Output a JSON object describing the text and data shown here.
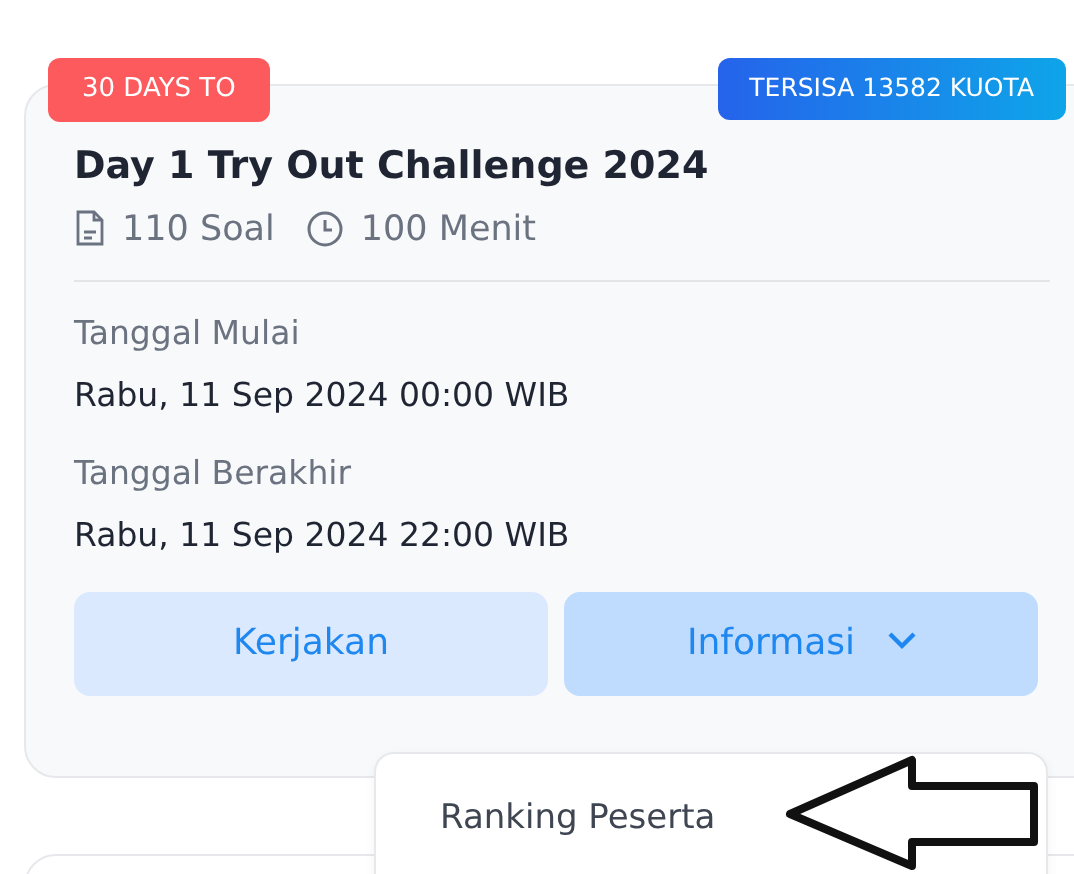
{
  "card": {
    "countdown_badge": "30 DAYS TO",
    "quota_badge": "TERSISA 13582 KUOTA",
    "title": "Day 1 Try Out Challenge 2024",
    "meta": [
      {
        "kind": "document",
        "text": "110 Soal"
      },
      {
        "kind": "clock",
        "text": "100 Menit"
      }
    ],
    "dates": [
      {
        "label": "Tanggal Mulai",
        "value": "Rabu, 11 Sep 2024 00:00 WIB"
      },
      {
        "label": "Tanggal Berakhir",
        "value": "Rabu, 11 Sep 2024 22:00 WIB"
      }
    ],
    "buttons": [
      {
        "label": "Kerjakan",
        "kind": "plain"
      },
      {
        "label": "Informasi",
        "kind": "dropdown",
        "expanded": true
      }
    ],
    "dropdown_items": [
      "Ranking Peserta"
    ]
  }
}
